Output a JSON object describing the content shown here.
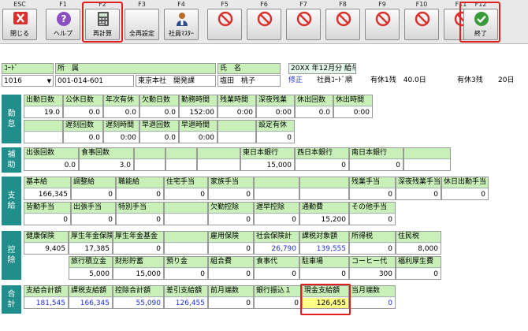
{
  "toolbar": {
    "keys": [
      {
        "fk": "ESC",
        "label": "閉じる",
        "icon": "close-x-icon"
      },
      {
        "fk": "F1",
        "label": "ヘルプ",
        "icon": "help-icon"
      },
      {
        "fk": "F2",
        "label": "再計算",
        "icon": "calculator-icon"
      },
      {
        "fk": "F3",
        "label": "全再設定",
        "icon": "blank-icon"
      },
      {
        "fk": "F4",
        "label": "社員ﾏｽﾀｰ",
        "icon": "employee-icon"
      },
      {
        "fk": "F5",
        "label": "",
        "icon": "no-icon"
      },
      {
        "fk": "F6",
        "label": "",
        "icon": "no-icon"
      },
      {
        "fk": "F7",
        "label": "",
        "icon": "no-icon"
      },
      {
        "fk": "F8",
        "label": "",
        "icon": "no-icon"
      },
      {
        "fk": "F9",
        "label": "",
        "icon": "no-icon"
      },
      {
        "fk": "F10",
        "label": "",
        "icon": "no-icon"
      },
      {
        "fk": "F11",
        "label": "",
        "icon": "no-icon"
      },
      {
        "fk": "F12",
        "label": "終了",
        "icon": "check-icon"
      }
    ]
  },
  "header": {
    "code_label": "ｺｰﾄﾞ",
    "code_value": "1016",
    "dept_label": "所　属",
    "dept_code": "001-014-601",
    "dept_name": "東京本社　開発課",
    "name_label": "氏　名",
    "name_value": "塩田　桃子",
    "period": "20XX 年12月分 給与",
    "mode": "修正",
    "order": "社員ｺｰﾄﾞ順",
    "leave1": "有休1残　40.0日",
    "leave3": "有休3残",
    "leave3_value": "20日"
  },
  "sections": {
    "attendance": "勤\n怠",
    "allowance": "補\n助",
    "payment": "支\n給",
    "deduction": "控\n除",
    "total": "合\n計"
  },
  "attendance_row1": [
    {
      "l": "出勤日数",
      "v": "19.0"
    },
    {
      "l": "公休日数",
      "v": "0.0"
    },
    {
      "l": "年次有休",
      "v": "0.0"
    },
    {
      "l": "欠勤日数",
      "v": "0.0"
    },
    {
      "l": "勤務時間",
      "v": "152:00"
    },
    {
      "l": "残業時間",
      "v": "0:00"
    },
    {
      "l": "深夜残業",
      "v": "0:00"
    },
    {
      "l": "休出回数",
      "v": "0.0"
    },
    {
      "l": "休出時間",
      "v": "0:00"
    }
  ],
  "attendance_row2": [
    {
      "l": "",
      "v": ""
    },
    {
      "l": "遅刻回数",
      "v": "0.0"
    },
    {
      "l": "遅刻時間",
      "v": "0:00"
    },
    {
      "l": "早退回数",
      "v": "0.0"
    },
    {
      "l": "早退時間",
      "v": "0:00"
    },
    {
      "l": "",
      "v": ""
    },
    {
      "l": "設定有休",
      "v": "0"
    }
  ],
  "allowance_row": [
    {
      "l": "出張回数",
      "v": "0.0"
    },
    {
      "l": "食事回数",
      "v": "3.0"
    },
    {
      "l": "",
      "v": ""
    },
    {
      "l": "",
      "v": ""
    },
    {
      "l": "",
      "v": ""
    },
    {
      "l": "東日本銀行",
      "v": "15,000"
    },
    {
      "l": "西日本銀行",
      "v": "0"
    },
    {
      "l": "南日本銀行",
      "v": "0"
    },
    {
      "l": "",
      "v": ""
    }
  ],
  "payment_row1": [
    {
      "l": "基本給",
      "v": "166,345"
    },
    {
      "l": "調整給",
      "v": "0"
    },
    {
      "l": "職能給",
      "v": "0"
    },
    {
      "l": "住宅手当",
      "v": "0"
    },
    {
      "l": "家族手当",
      "v": "0"
    },
    {
      "l": "",
      "v": ""
    },
    {
      "l": "",
      "v": ""
    },
    {
      "l": "残業手当",
      "v": "0"
    },
    {
      "l": "深夜残業手当",
      "v": "0"
    },
    {
      "l": "休日出勤手当",
      "v": "0"
    }
  ],
  "payment_row2": [
    {
      "l": "皆勤手当",
      "v": "0"
    },
    {
      "l": "出張手当",
      "v": "0"
    },
    {
      "l": "特別手当",
      "v": "0"
    },
    {
      "l": "",
      "v": ""
    },
    {
      "l": "欠勤控除",
      "v": "0"
    },
    {
      "l": "遅早控除",
      "v": "0"
    },
    {
      "l": "通勤費",
      "v": "15,200"
    },
    {
      "l": "その他手当",
      "v": "0"
    }
  ],
  "deduction_row1": [
    {
      "l": "健康保険",
      "v": "9,405"
    },
    {
      "l": "厚生年金保険",
      "v": "17,385"
    },
    {
      "l": "厚生年金基金",
      "v": "0"
    },
    {
      "l": "",
      "v": ""
    },
    {
      "l": "雇用保険",
      "v": "0"
    },
    {
      "l": "社会保険計",
      "v": "26,790"
    },
    {
      "l": "課税対象額",
      "v": "139,555"
    },
    {
      "l": "所得税",
      "v": "0"
    },
    {
      "l": "住民税",
      "v": "8,000"
    }
  ],
  "deduction_row2": [
    {
      "l": "旅行積立金",
      "v": "5,000"
    },
    {
      "l": "財形貯蓄",
      "v": "15,000"
    },
    {
      "l": "預り金",
      "v": "0"
    },
    {
      "l": "組合費",
      "v": "0"
    },
    {
      "l": "食事代",
      "v": "0"
    },
    {
      "l": "駐車場",
      "v": "0"
    },
    {
      "l": "コーヒー代",
      "v": "300"
    },
    {
      "l": "福利厚生費",
      "v": "0"
    }
  ],
  "total_row": [
    {
      "l": "支給合計額",
      "v": "181,545"
    },
    {
      "l": "課税支給額",
      "v": "166,345"
    },
    {
      "l": "控除合計額",
      "v": "55,090"
    },
    {
      "l": "差引支給額",
      "v": "126,455"
    },
    {
      "l": "前月端数",
      "v": "0"
    },
    {
      "l": "銀行振込１",
      "v": "0"
    },
    {
      "l": "現金支給額",
      "v": "126,455"
    },
    {
      "l": "当月端数",
      "v": "0"
    }
  ]
}
